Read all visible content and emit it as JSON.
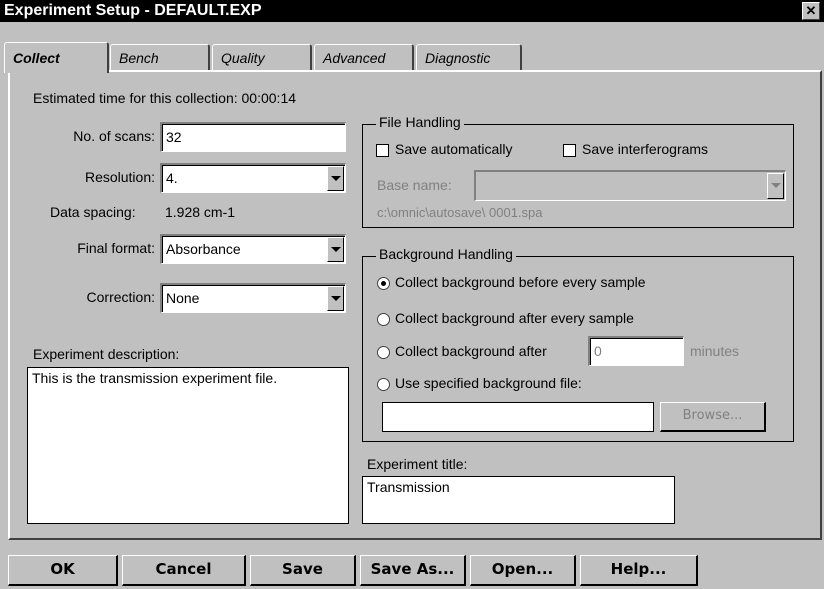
{
  "window": {
    "title": "Experiment Setup - DEFAULT.EXP",
    "close_glyph": "✕"
  },
  "tabs": [
    "Collect",
    "Bench",
    "Quality",
    "Advanced",
    "Diagnostic"
  ],
  "collect": {
    "estimated_time": "Estimated time for this collection: 00:00:14",
    "scans_label": "No. of scans:",
    "scans_value": "32",
    "resolution_label": "Resolution:",
    "resolution_value": "4.",
    "data_spacing_label": "Data spacing:",
    "data_spacing_value": "1.928 cm-1",
    "final_format_label": "Final format:",
    "final_format_value": "Absorbance",
    "correction_label": "Correction:",
    "correction_value": "None",
    "description_label": "Experiment description:",
    "description_value": "This is the transmission experiment file."
  },
  "file_handling": {
    "title": "File Handling",
    "save_auto": "Save automatically",
    "save_interferograms": "Save interferograms",
    "base_name_label": "Base name:",
    "base_name_value": "",
    "path": "c:\\omnic\\autosave\\ 0001.spa"
  },
  "background_handling": {
    "title": "Background Handling",
    "options": [
      "Collect background before every sample",
      "Collect background after every sample",
      "Collect background after",
      "Use specified background file:"
    ],
    "minutes_value": "0",
    "minutes_label": "minutes",
    "file_value": "",
    "browse_label": "Browse..."
  },
  "experiment_title": {
    "label": "Experiment title:",
    "value": "Transmission"
  },
  "buttons": {
    "ok": "OK",
    "cancel": "Cancel",
    "save": "Save",
    "save_as": "Save As...",
    "open": "Open...",
    "help": "Help..."
  }
}
